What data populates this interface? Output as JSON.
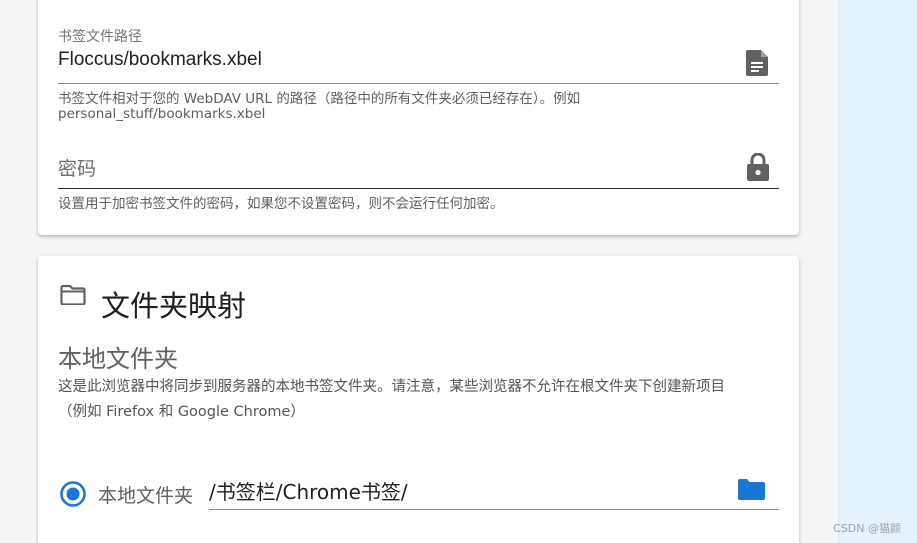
{
  "card_server": {
    "bookmark_path": {
      "label": "书签文件路径",
      "value": "Floccus/bookmarks.xbel",
      "icon": "file-document-icon",
      "hint_line1": "书签文件相对于您的 WebDAV URL 的路径（路径中的所有文件夹必须已经存在）。例如",
      "hint_line2": "personal_stuff/bookmarks.xbel"
    },
    "password": {
      "placeholder": "密码",
      "icon": "lock-icon",
      "hint": "设置用于加密书签文件的密码，如果您不设置密码，则不会运行任何加密。"
    }
  },
  "card_folder_mapping": {
    "title": "文件夹映射",
    "title_icon": "folder-outline-icon",
    "subtitle": "本地文件夹",
    "description_line1": "这是此浏览器中将同步到服务器的本地书签文件夹。请注意，某些浏览器不允许在根文件夹下创建新项目",
    "description_line2": "（例如 Firefox 和 Google Chrome）",
    "radio_label": "本地文件夹",
    "radio_selected": true,
    "path_value": "/书签栏/Chrome书签/",
    "path_icon": "folder-icon"
  },
  "watermark": "CSDN @猫颜",
  "colors": {
    "accent": "#1976d2",
    "icon_grey": "#616161",
    "side_panel": "#e3f2fd"
  }
}
